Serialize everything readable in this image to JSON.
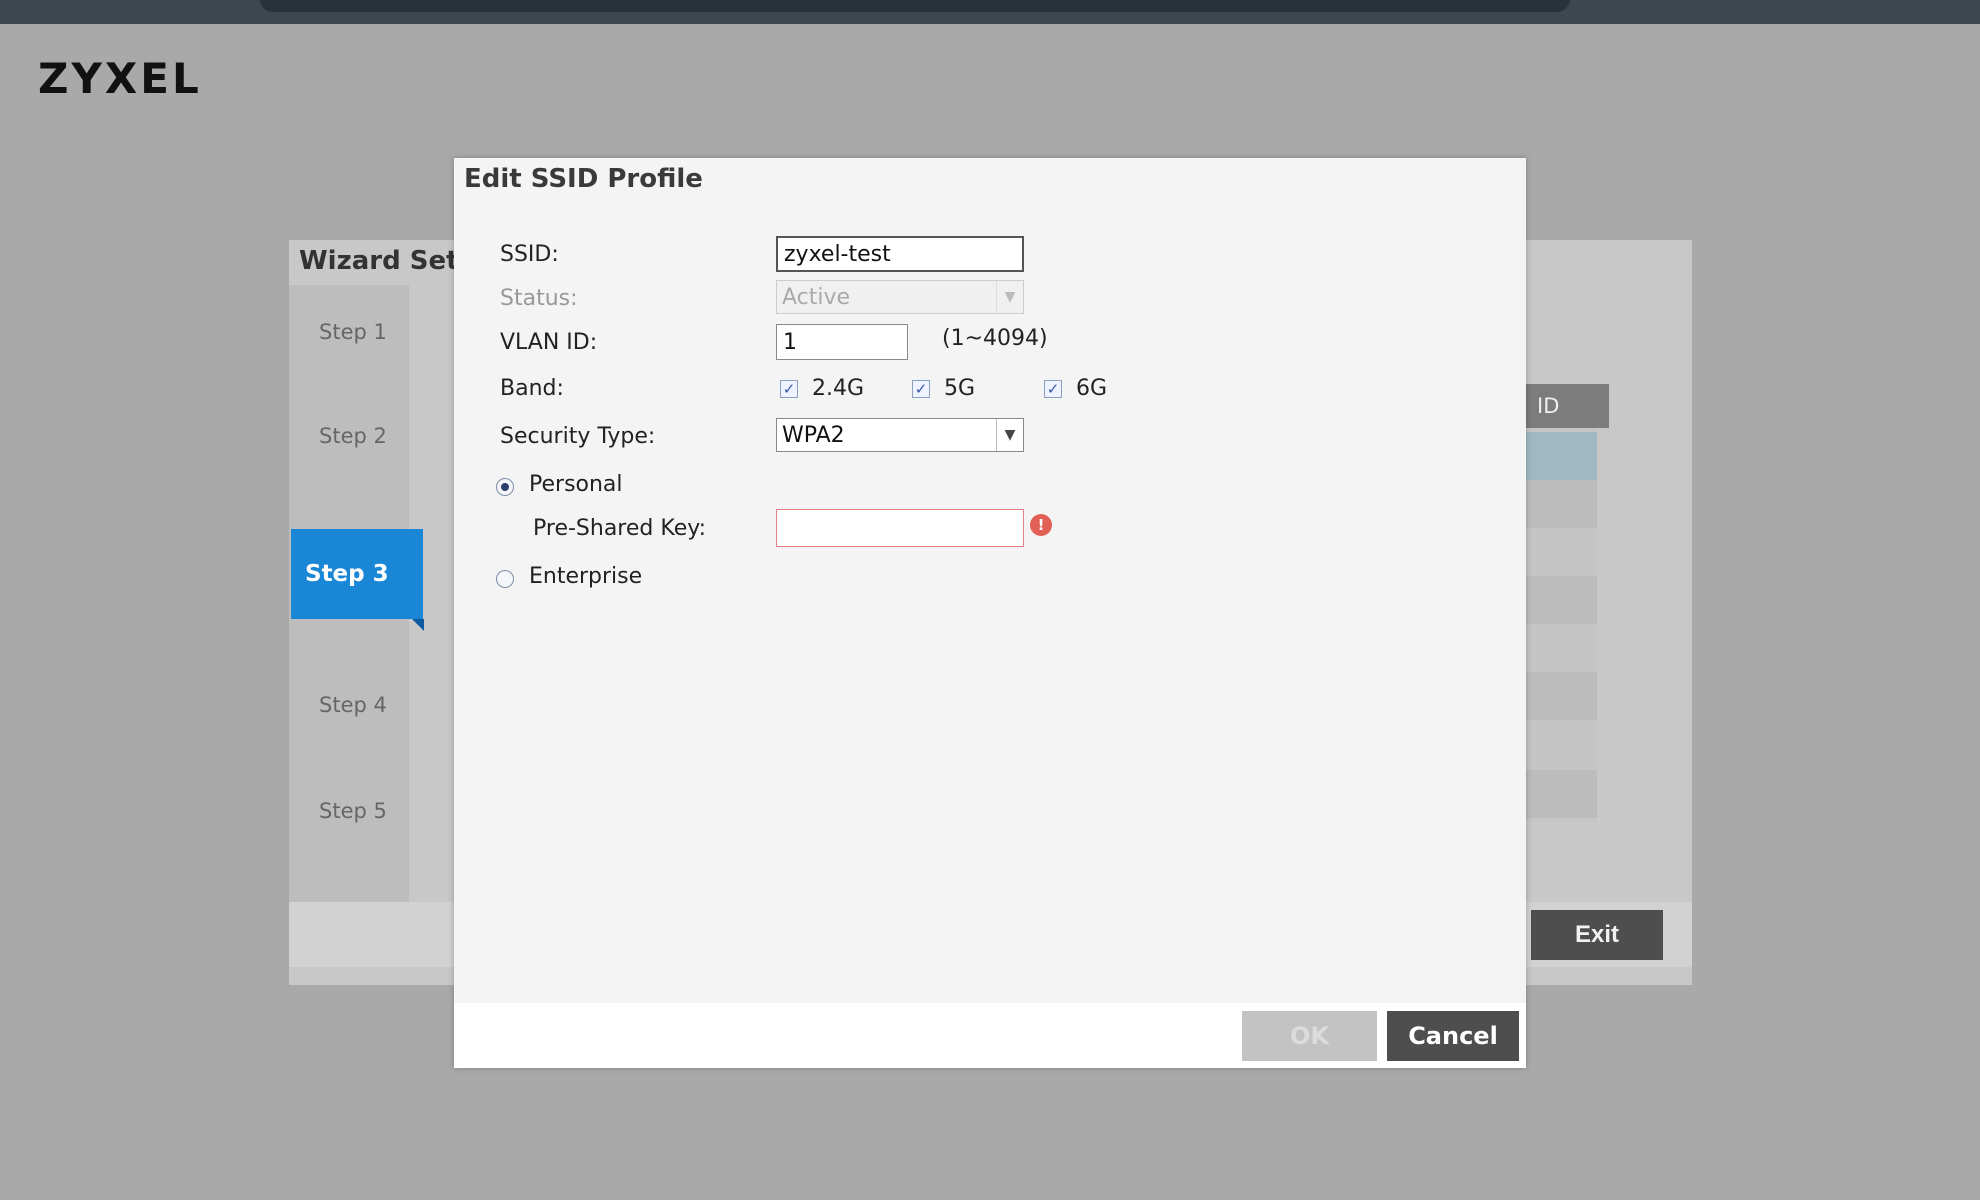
{
  "brand": {
    "logo_text": "ZYXEL"
  },
  "wizard": {
    "title": "Wizard Sett",
    "steps": [
      "Step 1",
      "Step 2",
      "Step 3",
      "Step 4",
      "Step 5"
    ],
    "active_step_index": 2,
    "column_header": "ID",
    "exit_label": "Exit"
  },
  "dialog": {
    "title": "Edit SSID Profile",
    "ssid": {
      "label": "SSID:",
      "value": "zyxel-test"
    },
    "status": {
      "label": "Status:",
      "value": "Active"
    },
    "vlan": {
      "label": "VLAN ID:",
      "value": "1",
      "range_hint": "(1~4094)"
    },
    "band": {
      "label": "Band:",
      "options": [
        {
          "label": "2.4G",
          "checked": true
        },
        {
          "label": "5G",
          "checked": true
        },
        {
          "label": "6G",
          "checked": true
        }
      ]
    },
    "security": {
      "label": "Security Type:",
      "value": "WPA2"
    },
    "mode": {
      "personal_label": "Personal",
      "enterprise_label": "Enterprise",
      "selected": "Personal"
    },
    "psk": {
      "label": "Pre-Shared Key:",
      "value": ""
    },
    "buttons": {
      "ok": "OK",
      "cancel": "Cancel"
    }
  },
  "colors": {
    "accent_blue": "#1a86d6",
    "overlay_gray": "#a9a9a9",
    "error_red": "#e25f55",
    "button_dark": "#4e4e4e"
  },
  "icons": {
    "dropdown": "chevron-down-icon",
    "error": "warning-icon",
    "checkbox": "checkmark-icon"
  }
}
